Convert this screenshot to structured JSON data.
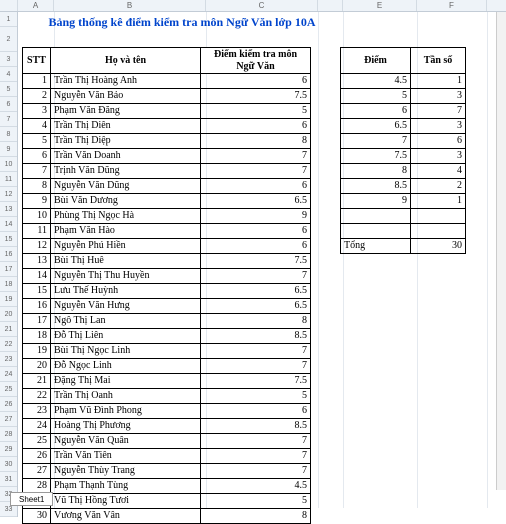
{
  "title": "Bảng thống kê điểm kiểm tra môn Ngữ Văn lớp 10A",
  "columns": [
    "A",
    "B",
    "C",
    "D",
    "E",
    "F"
  ],
  "main_headers": {
    "stt": "STT",
    "name": "Họ và tên",
    "score": "Điểm kiểm tra môn Ngữ Văn"
  },
  "side_headers": {
    "diem": "Điểm",
    "ts": "Tần số"
  },
  "tong_label": "Tổng",
  "tong_value": "30",
  "sheet_tab": "Sheet1",
  "rows": [
    {
      "stt": "1",
      "name": "Trần Thị Hoàng Anh",
      "score": "6"
    },
    {
      "stt": "2",
      "name": "Nguyễn Văn Bảo",
      "score": "7.5"
    },
    {
      "stt": "3",
      "name": "Phạm Văn Đăng",
      "score": "5"
    },
    {
      "stt": "4",
      "name": "Trần Thị Diên",
      "score": "6"
    },
    {
      "stt": "5",
      "name": "Trần Thị Diệp",
      "score": "8"
    },
    {
      "stt": "6",
      "name": "Trần Văn Doanh",
      "score": "7"
    },
    {
      "stt": "7",
      "name": "Trịnh Văn Dũng",
      "score": "7"
    },
    {
      "stt": "8",
      "name": "Nguyễn Văn Dũng",
      "score": "6"
    },
    {
      "stt": "9",
      "name": "Bùi Văn Dương",
      "score": "6.5"
    },
    {
      "stt": "10",
      "name": "Phùng Thị Ngọc Hà",
      "score": "9"
    },
    {
      "stt": "11",
      "name": "Phạm Văn Hào",
      "score": "6"
    },
    {
      "stt": "12",
      "name": "Nguyễn Phú Hiền",
      "score": "6"
    },
    {
      "stt": "13",
      "name": "Bùi Thị Huê",
      "score": "7.5"
    },
    {
      "stt": "14",
      "name": "Nguyễn Thị Thu Huyền",
      "score": "7"
    },
    {
      "stt": "15",
      "name": "Lưu Thế Huỳnh",
      "score": "6.5"
    },
    {
      "stt": "16",
      "name": "Nguyễn Văn Hưng",
      "score": "6.5"
    },
    {
      "stt": "17",
      "name": "Ngô Thị Lan",
      "score": "8"
    },
    {
      "stt": "18",
      "name": "Đỗ Thị Liên",
      "score": "8.5"
    },
    {
      "stt": "19",
      "name": "Bùi Thị Ngọc Linh",
      "score": "7"
    },
    {
      "stt": "20",
      "name": "Đỗ Ngọc Linh",
      "score": "7"
    },
    {
      "stt": "21",
      "name": "Đặng Thị Mai",
      "score": "7.5"
    },
    {
      "stt": "22",
      "name": "Trần Thị Oanh",
      "score": "5"
    },
    {
      "stt": "23",
      "name": "Phạm Vũ Đình Phong",
      "score": "6"
    },
    {
      "stt": "24",
      "name": "Hoàng Thị Phương",
      "score": "8.5"
    },
    {
      "stt": "25",
      "name": "Nguyễn Văn Quân",
      "score": "7"
    },
    {
      "stt": "26",
      "name": "Trần Văn Tiên",
      "score": "7"
    },
    {
      "stt": "27",
      "name": "Nguyễn Thùy Trang",
      "score": "7"
    },
    {
      "stt": "28",
      "name": "Phạm Thạnh Tùng",
      "score": "4.5"
    },
    {
      "stt": "29",
      "name": "Vũ Thị Hồng Tươi",
      "score": "5"
    },
    {
      "stt": "30",
      "name": "Vương Văn Vân",
      "score": "8"
    }
  ],
  "freq": [
    {
      "diem": "4.5",
      "ts": "1"
    },
    {
      "diem": "5",
      "ts": "3"
    },
    {
      "diem": "6",
      "ts": "7"
    },
    {
      "diem": "6.5",
      "ts": "3"
    },
    {
      "diem": "7",
      "ts": "6"
    },
    {
      "diem": "7.5",
      "ts": "3"
    },
    {
      "diem": "8",
      "ts": "4"
    },
    {
      "diem": "8.5",
      "ts": "2"
    },
    {
      "diem": "9",
      "ts": "1"
    }
  ],
  "chart_data": {
    "type": "table",
    "title": "Bảng thống kê điểm kiểm tra môn Ngữ Văn lớp 10A",
    "categories": [
      "4.5",
      "5",
      "6",
      "6.5",
      "7",
      "7.5",
      "8",
      "8.5",
      "9"
    ],
    "values": [
      1,
      3,
      7,
      3,
      6,
      3,
      4,
      2,
      1
    ],
    "xlabel": "Điểm",
    "ylabel": "Tần số",
    "total": 30
  }
}
